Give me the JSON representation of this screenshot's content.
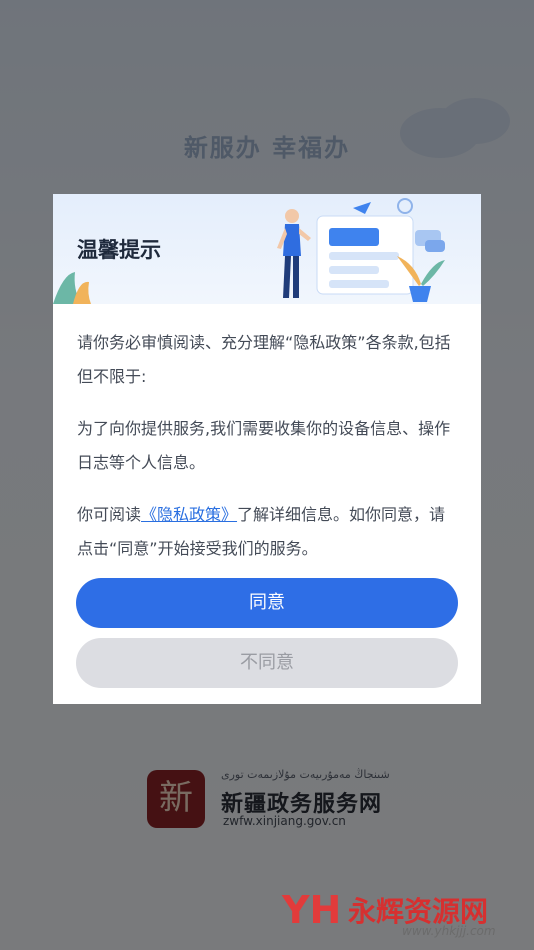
{
  "background": {
    "slogan": "新服办  幸福办"
  },
  "dialog": {
    "title": "温馨提示",
    "paragraph_1": "请你务必审慎阅读、充分理解“隐私政策”各条款,包括但不限于:",
    "paragraph_2": "为了向你提供服务,我们需要收集你的设备信息、操作日志等个人信息。",
    "paragraph_3_prefix": "你可阅读",
    "privacy_link": "《隐私政策》",
    "paragraph_3_suffix": "了解详细信息。如你同意，请点击“同意”开始接受我们的服务。",
    "agree_label": "同意",
    "disagree_label": "不同意"
  },
  "brand": {
    "logo_char": "新",
    "uyghur_text": "شىنجاڭ مەمۇرىيەت مۇلازىمەت تورى",
    "name": "新疆政务服务网",
    "url": "zwfw.xinjiang.gov.cn"
  },
  "watermark": {
    "logo": "YH",
    "name": "永辉资源网",
    "url": "www.yhkjjj.com"
  },
  "colors": {
    "accent": "#2e6ee6",
    "disabled_button": "#dcdde2",
    "overlay": "rgba(0,0,0,0.5)",
    "brand_red": "#8b2326"
  }
}
